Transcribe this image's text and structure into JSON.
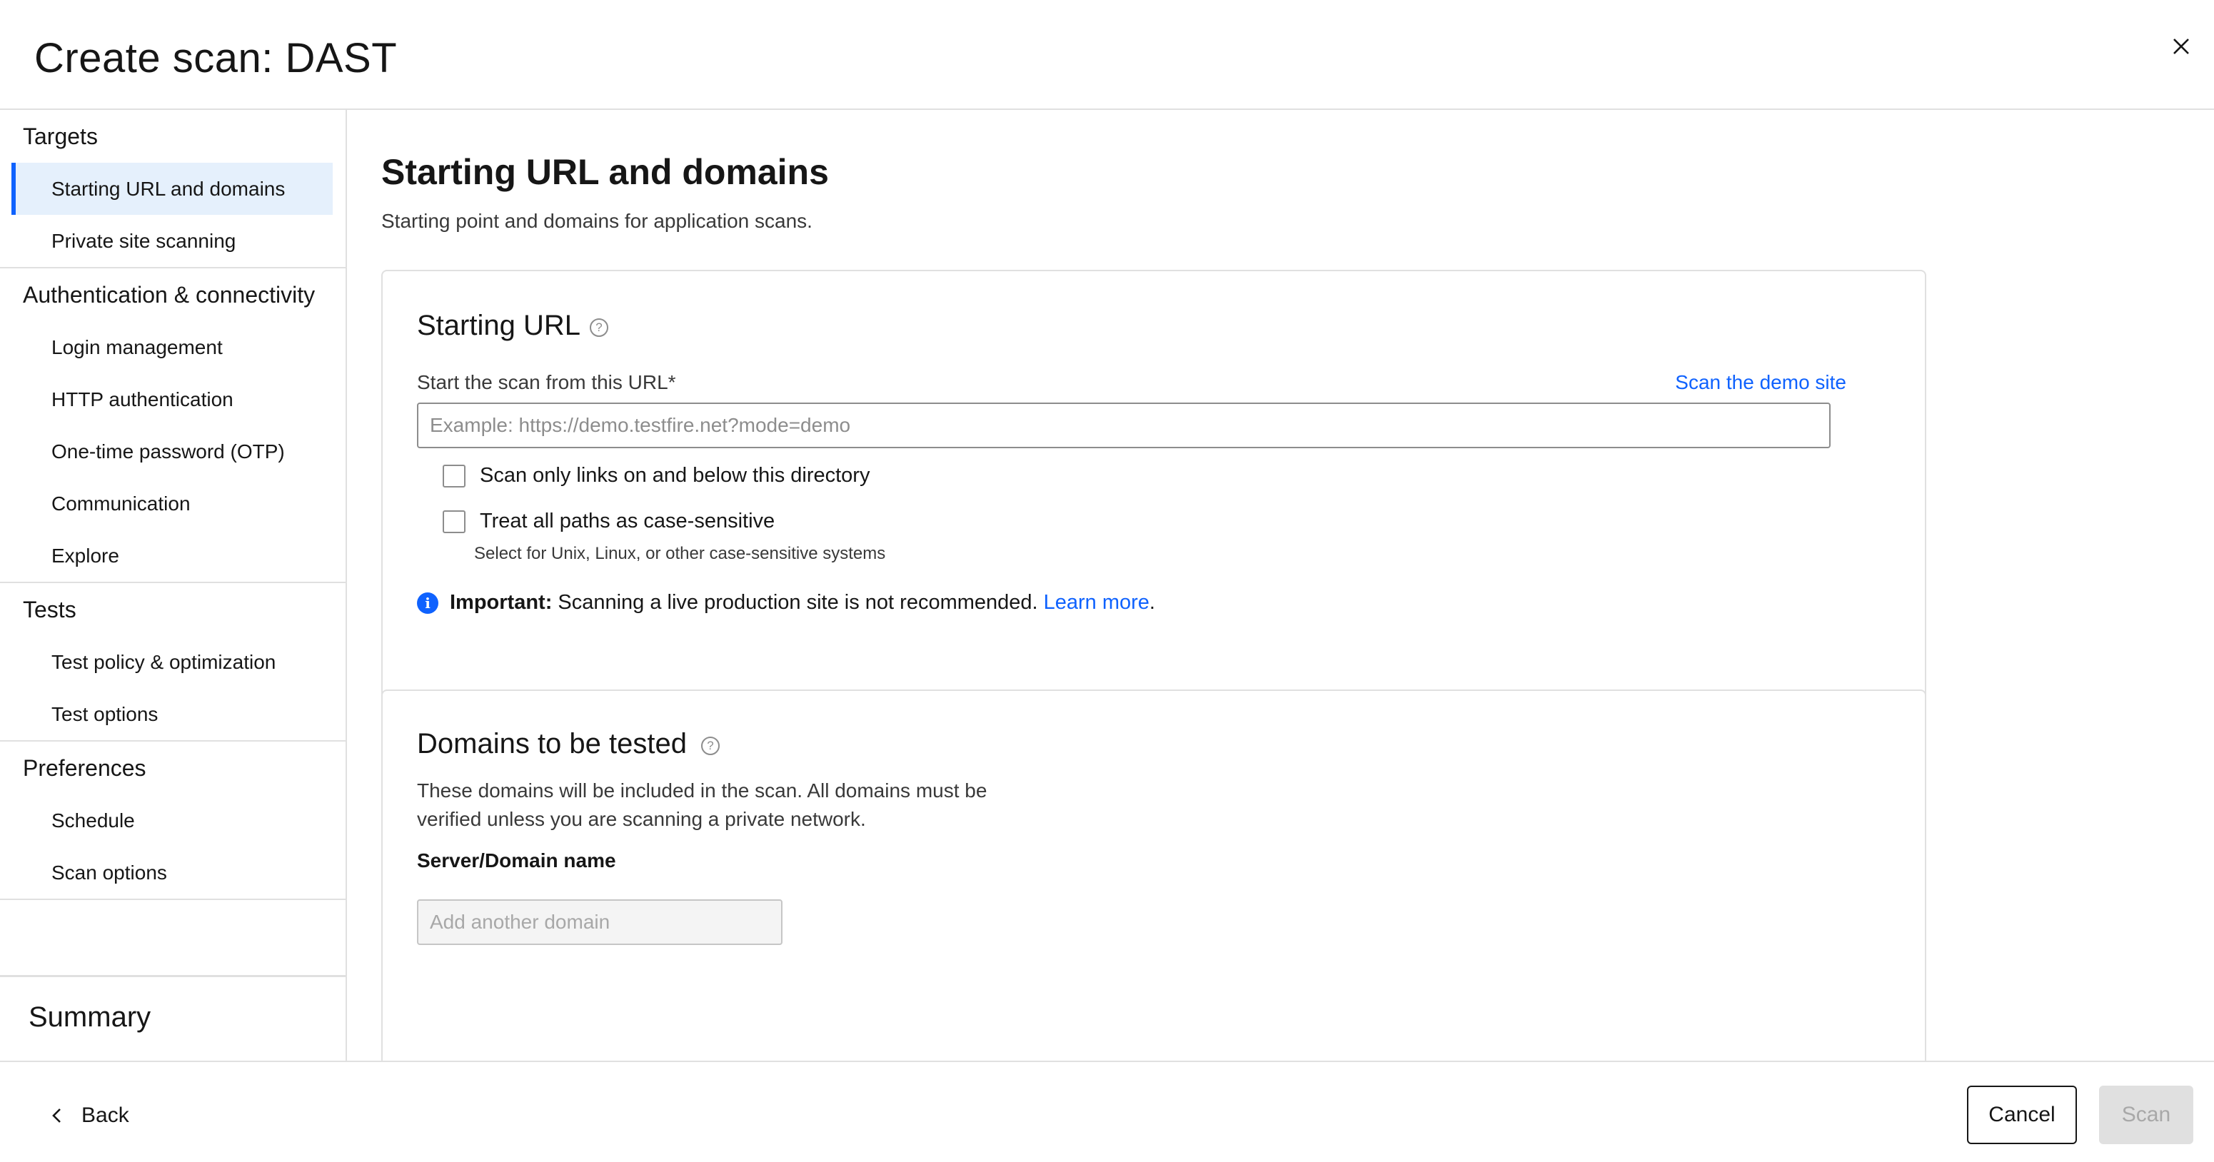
{
  "header": {
    "title": "Create scan: DAST",
    "close_icon": "close-icon"
  },
  "sidebar": {
    "sections": [
      {
        "heading": "Targets",
        "items": [
          "Starting URL and domains",
          "Private site scanning"
        ]
      },
      {
        "heading": "Authentication & connectivity",
        "items": [
          "Login management",
          "HTTP authentication",
          "One-time password (OTP)",
          "Communication",
          "Explore"
        ]
      },
      {
        "heading": "Tests",
        "items": [
          "Test policy & optimization",
          "Test options"
        ]
      },
      {
        "heading": "Preferences",
        "items": [
          "Schedule",
          "Scan options"
        ]
      }
    ],
    "active_item": "Starting URL and domains",
    "summary_label": "Summary"
  },
  "main": {
    "title": "Starting URL and domains",
    "description": "Starting point and domains for application scans.",
    "starting_url": {
      "title": "Starting URL",
      "help_icon": "help-icon",
      "field_label": "Start the scan from this URL*",
      "demo_link": "Scan the demo site",
      "placeholder": "Example: https://demo.testfire.net?mode=demo",
      "value": "",
      "checkbox_scan_below": {
        "label": "Scan only links on and below this directory",
        "checked": false
      },
      "checkbox_case_sensitive": {
        "label": "Treat all paths as case-sensitive",
        "checked": false,
        "hint": "Select for Unix, Linux, or other case-sensitive systems"
      },
      "notice": {
        "icon": "info-icon",
        "bold": "Important:",
        "text": "Scanning a live production site is not recommended.",
        "link": "Learn more",
        "suffix": "."
      }
    },
    "domains": {
      "title": "Domains to be tested",
      "help_icon": "help-icon",
      "description": "These domains will be included in the scan. All domains must be verified unless you are scanning a private network.",
      "field_label": "Server/Domain name",
      "placeholder": "Add another domain"
    }
  },
  "footer": {
    "back_label": "Back",
    "back_icon": "chevron-left-icon",
    "cancel_label": "Cancel",
    "scan_label": "Scan",
    "scan_disabled": true
  },
  "colors": {
    "accent": "#0f62fe",
    "active_nav_bg": "#e5f0fc",
    "border": "#e0e0e0",
    "disabled_bg": "#e0e0e0"
  }
}
